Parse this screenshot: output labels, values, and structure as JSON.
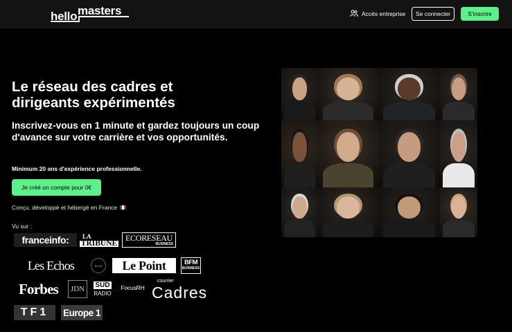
{
  "header": {
    "logo_hello": "hello",
    "logo_masters": "masters",
    "entreprise_label": "Accès entreprise",
    "login_label": "Se connecter",
    "signup_label": "S'inscrire"
  },
  "hero": {
    "title": "Le réseau des cadres et dirigeants expérimentés",
    "subtitle": "Inscrivez-vous en 1 minute et gardez toujours un coup d'avance sur votre carrière et vos opportunités.",
    "requirement": "Minimum 20 ans d'expérience professionnelle.",
    "cta_label": "Je créé un compte pour 0€",
    "made_in": "Conçu, développé et hébergé en France",
    "seen_on": "Vu sur :"
  },
  "press": {
    "franceinfo": "franceinfo:",
    "tribune_a": "LA",
    "tribune_b": "TRIBUNE",
    "ecoreseau_a": "ECORESEAU",
    "ecoreseau_b": "BUSINESS",
    "lesechos": "Les Echos",
    "circle": "PLUS",
    "lepoint": "Le Point",
    "bfm_a": "BFM",
    "bfm_b": "BUSINESS",
    "forbes": "Forbes",
    "jdn": "JDN",
    "sud_a": "SUD",
    "sud_b": "RADIO",
    "focus": "FocusRH",
    "cadres_a": "courrier",
    "cadres_b": "Cadres",
    "tf1": "TF1",
    "europe": "Europe 1"
  },
  "colors": {
    "accent": "#5ef08a",
    "background": "#000000",
    "header": "#131313"
  },
  "icons": {
    "entreprise": "people-icon",
    "flag": "french-flag-icon"
  },
  "portraits": [
    {
      "skin": "#c9a185",
      "hair": "#2a2420",
      "cloth": "#1a1a1a",
      "bg": "#2a241f"
    },
    {
      "skin": "#d7b294",
      "hair": "#a07a55",
      "cloth": "#2b2b2b",
      "bg": "#3a3029"
    },
    {
      "skin": "#5a3b2b",
      "hair": "#cfcfcf",
      "cloth": "#222326",
      "bg": "#2b2622"
    },
    {
      "skin": "#c79c83",
      "hair": "#6a5a50",
      "cloth": "#2a2a2a",
      "bg": "#2d2722"
    },
    {
      "skin": "#7a5239",
      "hair": "#1a1512",
      "cloth": "#1e1e1e",
      "bg": "#33291f"
    },
    {
      "skin": "#d1a98b",
      "hair": "#6b4e35",
      "cloth": "#4a4330",
      "bg": "#3b3126"
    },
    {
      "skin": "#c79b7f",
      "hair": "#2e2620",
      "cloth": "#1f1f1f",
      "bg": "#2a2520"
    },
    {
      "skin": "#caa087",
      "hair": "#bdbdbd",
      "cloth": "#e8e8e8",
      "bg": "#2e2824"
    },
    {
      "skin": "#cfa891",
      "hair": "#d8d8d8",
      "cloth": "#222",
      "bg": "#2d2925"
    },
    {
      "skin": "#d9b69c",
      "hair": "#b59673",
      "cloth": "#1d1d1d",
      "bg": "#332b24"
    },
    {
      "skin": "#c29a78",
      "hair": "#151210",
      "cloth": "#1a1a1a",
      "bg": "#2b2520"
    },
    {
      "skin": "#d8b39a",
      "hair": "#c7a47c",
      "cloth": "#2a2a2a",
      "bg": "#3a3027"
    }
  ]
}
